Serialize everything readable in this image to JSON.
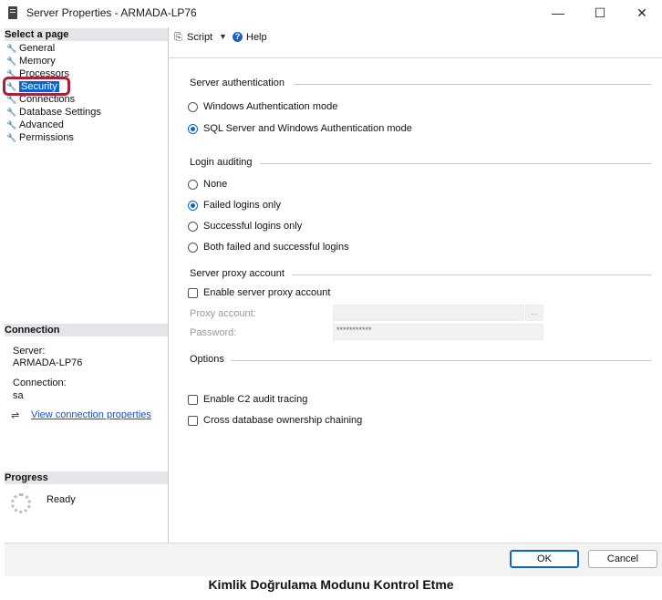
{
  "window": {
    "title": "Server Properties - ARMADA-LP76",
    "minimize": "—",
    "maximize": "☐",
    "close": "✕"
  },
  "left": {
    "select_page_header": "Select a page",
    "pages": [
      {
        "label": "General"
      },
      {
        "label": "Memory"
      },
      {
        "label": "Processors"
      },
      {
        "label": "Security"
      },
      {
        "label": "Connections"
      },
      {
        "label": "Database Settings"
      },
      {
        "label": "Advanced"
      },
      {
        "label": "Permissions"
      }
    ],
    "connection_header": "Connection",
    "server_label": "Server:",
    "server_value": "ARMADA-LP76",
    "connection_label": "Connection:",
    "connection_value": "sa",
    "view_link": "View connection properties",
    "progress_header": "Progress",
    "progress_status": "Ready"
  },
  "toolbar": {
    "script_label": "Script",
    "help_label": "Help"
  },
  "server_auth": {
    "title": "Server authentication",
    "options": [
      {
        "label": "Windows Authentication mode",
        "selected": false
      },
      {
        "label": "SQL Server and Windows Authentication mode",
        "selected": true
      }
    ]
  },
  "login_auditing": {
    "title": "Login auditing",
    "options": [
      {
        "label": "None",
        "selected": false
      },
      {
        "label": "Failed logins only",
        "selected": true
      },
      {
        "label": "Successful logins only",
        "selected": false
      },
      {
        "label": "Both failed and successful logins",
        "selected": false
      }
    ]
  },
  "proxy": {
    "title": "Server proxy account",
    "enable_label": "Enable server proxy account",
    "proxy_account_label": "Proxy account:",
    "browse_label": "...",
    "password_label": "Password:",
    "password_value": "***********"
  },
  "options": {
    "title": "Options",
    "c2_label": "Enable C2 audit tracing",
    "cross_db_label": "Cross database ownership chaining"
  },
  "buttons": {
    "ok": "OK",
    "cancel": "Cancel"
  },
  "caption": "Kimlik Doğrulama Modunu Kontrol Etme",
  "colors": {
    "accent": "#0a64d6",
    "highlight_ring": "#a8233a",
    "section_header_bg": "#e3e5e8"
  }
}
